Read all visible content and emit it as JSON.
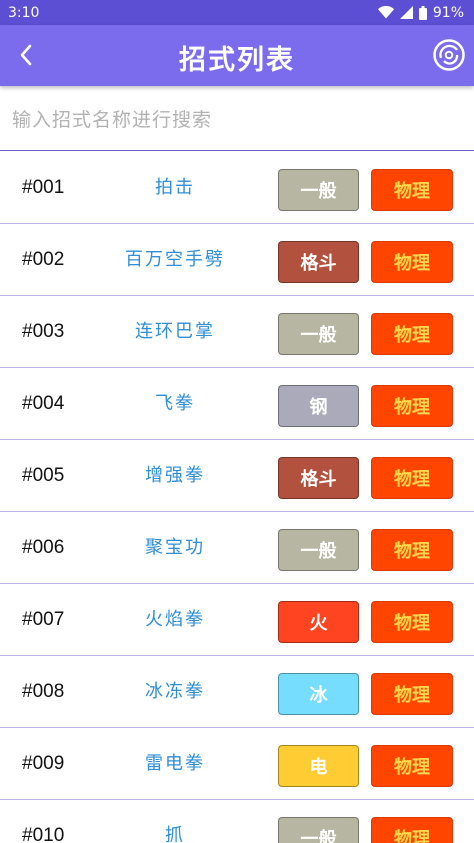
{
  "status_bar": {
    "time": "3:10",
    "battery": "91%"
  },
  "app_bar": {
    "title": "招式列表"
  },
  "search": {
    "placeholder": "输入招式名称进行搜索"
  },
  "type_colors": {
    "一般": "#b6b6a3",
    "格斗": "#b3513f",
    "钢": "#aaaabb",
    "火": "#ff4422",
    "冰": "#77ddff",
    "电": "#ffcc33"
  },
  "category_color": "#ff4500",
  "moves": [
    {
      "num": "#001",
      "name": "拍击",
      "type": "一般",
      "category": "物理"
    },
    {
      "num": "#002",
      "name": "百万空手劈",
      "type": "格斗",
      "category": "物理"
    },
    {
      "num": "#003",
      "name": "连环巴掌",
      "type": "一般",
      "category": "物理"
    },
    {
      "num": "#004",
      "name": "飞拳",
      "type": "钢",
      "category": "物理"
    },
    {
      "num": "#005",
      "name": "增强拳",
      "type": "格斗",
      "category": "物理"
    },
    {
      "num": "#006",
      "name": "聚宝功",
      "type": "一般",
      "category": "物理"
    },
    {
      "num": "#007",
      "name": "火焰拳",
      "type": "火",
      "category": "物理"
    },
    {
      "num": "#008",
      "name": "冰冻拳",
      "type": "冰",
      "category": "物理"
    },
    {
      "num": "#009",
      "name": "雷电拳",
      "type": "电",
      "category": "物理"
    },
    {
      "num": "#010",
      "name": "抓",
      "type": "一般",
      "category": "物理"
    }
  ]
}
